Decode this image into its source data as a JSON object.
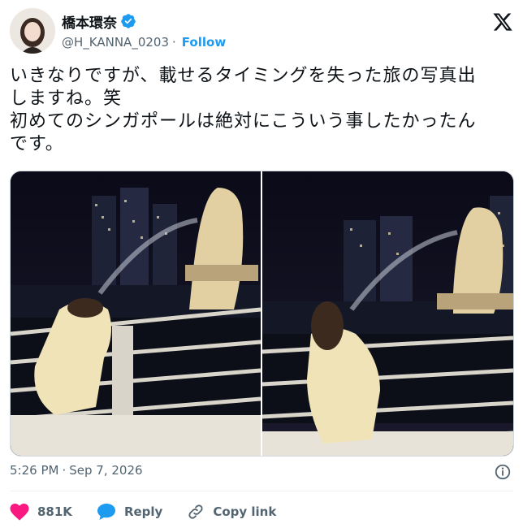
{
  "author": {
    "display_name": "橋本環奈",
    "handle": "@H_KANNA_0203",
    "separator": "·",
    "follow_label": "Follow"
  },
  "tweet": {
    "lines": [
      "いきなりですが、載せるタイミングを失った旅の写真出",
      "しますね。笑",
      "初めてのシンガポールは絶対にこういう事したかったん",
      "です。"
    ]
  },
  "meta": {
    "time": "5:26 PM",
    "separator": "·",
    "date": "Sep 7, 2026"
  },
  "actions": {
    "likes": "881K",
    "reply_label": "Reply",
    "copy_link_label": "Copy link"
  },
  "colors": {
    "accent": "#1d9bf0",
    "like": "#f91880",
    "text": "#0f1419",
    "muted": "#536471"
  },
  "icons": [
    "verified-badge-icon",
    "x-logo-icon",
    "info-icon",
    "heart-icon",
    "reply-bubble-icon",
    "link-icon"
  ]
}
